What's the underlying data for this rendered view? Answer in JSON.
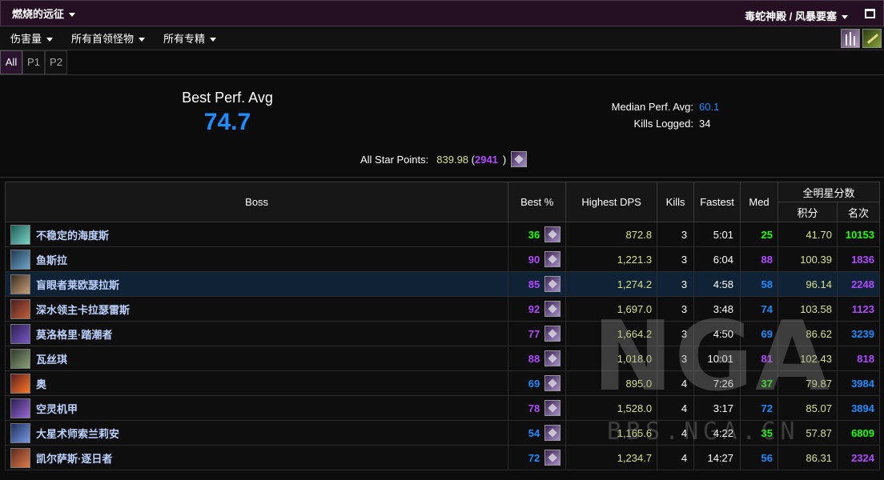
{
  "topbar": {
    "title": "燃烧的远征",
    "zone": "毒蛇神殿 / 风暴要塞"
  },
  "filters": {
    "metric": "伤害量",
    "bosses": "所有首领怪物",
    "specs": "所有专精"
  },
  "tabs": [
    "All",
    "P1",
    "P2"
  ],
  "summary": {
    "best_perf_label": "Best Perf. Avg",
    "best_perf_value": "74.7",
    "median_label": "Median Perf. Avg:",
    "median_value": "60.1",
    "kills_label": "Kills Logged:",
    "kills_value": "34",
    "star_label": "All Star Points:",
    "star_points": "839.98",
    "star_rank": "2941"
  },
  "table": {
    "headers": {
      "boss": "Boss",
      "best": "Best %",
      "dps": "Highest DPS",
      "kills": "Kills",
      "fastest": "Fastest",
      "med": "Med",
      "allstar": "全明星分数",
      "points": "积分",
      "rank": "名次"
    },
    "rows": [
      {
        "boss": "不稳定的海度斯",
        "best": "36",
        "dps": "872.8",
        "kills": "3",
        "fastest": "5:01",
        "med": "25",
        "points": "41.70",
        "rank": "10153"
      },
      {
        "boss": "鱼斯拉",
        "best": "90",
        "dps": "1,221.3",
        "kills": "3",
        "fastest": "6:04",
        "med": "88",
        "points": "100.39",
        "rank": "1836"
      },
      {
        "boss": "盲眼者莱欧瑟拉斯",
        "best": "85",
        "dps": "1,274.2",
        "kills": "3",
        "fastest": "4:58",
        "med": "58",
        "points": "96.14",
        "rank": "2248"
      },
      {
        "boss": "深水领主卡拉瑟雷斯",
        "best": "92",
        "dps": "1,697.0",
        "kills": "3",
        "fastest": "3:48",
        "med": "74",
        "points": "103.58",
        "rank": "1123"
      },
      {
        "boss": "莫洛格里·踏潮者",
        "best": "77",
        "dps": "1,664.2",
        "kills": "3",
        "fastest": "4:50",
        "med": "69",
        "points": "86.62",
        "rank": "3239"
      },
      {
        "boss": "瓦丝琪",
        "best": "88",
        "dps": "1,018.0",
        "kills": "3",
        "fastest": "10:01",
        "med": "81",
        "points": "102.43",
        "rank": "818"
      },
      {
        "boss": "奥",
        "best": "69",
        "dps": "895.0",
        "kills": "4",
        "fastest": "7:26",
        "med": "37",
        "points": "79.87",
        "rank": "3984"
      },
      {
        "boss": "空灵机甲",
        "best": "78",
        "dps": "1,528.0",
        "kills": "4",
        "fastest": "3:17",
        "med": "72",
        "points": "85.07",
        "rank": "3894"
      },
      {
        "boss": "大星术师索兰莉安",
        "best": "54",
        "dps": "1,165.6",
        "kills": "4",
        "fastest": "4:22",
        "med": "35",
        "points": "57.87",
        "rank": "6809"
      },
      {
        "boss": "凯尔萨斯·逐日者",
        "best": "72",
        "dps": "1,234.7",
        "kills": "4",
        "fastest": "14:27",
        "med": "56",
        "points": "86.31",
        "rank": "2324"
      }
    ]
  },
  "watermark": {
    "logo": "NGA",
    "url": "BBS.NGA.CN"
  },
  "colors": {
    "blue": "#1f8cff",
    "purple": "#b04bff",
    "green": "#1eff00",
    "gold": "#d6e28a"
  }
}
